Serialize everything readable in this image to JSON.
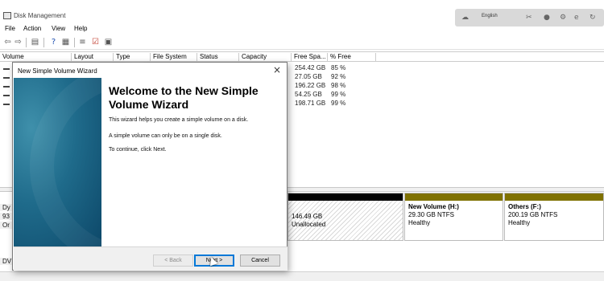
{
  "app": {
    "title": "Disk Management"
  },
  "tray": {
    "language": "English"
  },
  "menu": [
    "File",
    "Action",
    "View",
    "Help"
  ],
  "columns": [
    "Volume",
    "Layout",
    "Type",
    "File System",
    "Status",
    "Capacity",
    "Free Spa...",
    "% Free"
  ],
  "volumes": [
    {
      "free": "254.42 GB",
      "pct": "85 %"
    },
    {
      "free": "27.05 GB",
      "pct": "92 %"
    },
    {
      "free": "196.22 GB",
      "pct": "98 %"
    },
    {
      "free": "54.25 GB",
      "pct": "99 %"
    },
    {
      "free": "198.71 GB",
      "pct": "99 %"
    }
  ],
  "disk_labels": [
    "Dy",
    "93",
    "Or",
    "DV"
  ],
  "partitions": [
    {
      "name": "",
      "size": "146.49 GB",
      "fs": "Unallocated",
      "status": "",
      "bar_color": "#000000"
    },
    {
      "name": "New Volume  (H:)",
      "size": "29.30 GB NTFS",
      "fs": "",
      "status": "Healthy",
      "bar_color": "#7f7100"
    },
    {
      "name": "Others  (F:)",
      "size": "200.19 GB NTFS",
      "fs": "",
      "status": "Healthy",
      "bar_color": "#7f7100"
    }
  ],
  "wizard": {
    "title": "New Simple Volume Wizard",
    "heading": "Welcome to the New Simple Volume Wizard",
    "para1": "This wizard helps you create a simple volume on a disk.",
    "para2": "A simple volume can only be on a single disk.",
    "para3": "To continue, click Next.",
    "back_label": "< Back",
    "next_label": "Next >",
    "cancel_label": "Cancel"
  }
}
